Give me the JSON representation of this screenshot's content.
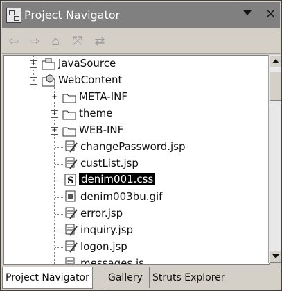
{
  "title": "Project Navigator",
  "titlebar": {
    "menu_icon": "view-menu-icon",
    "close_label": "×"
  },
  "toolbar": {
    "buttons": [
      {
        "name": "back",
        "glyph": "⇦"
      },
      {
        "name": "forward",
        "glyph": "⇨"
      },
      {
        "name": "up",
        "glyph": "⌂"
      },
      {
        "name": "collapse-all",
        "glyph": "⤧"
      },
      {
        "name": "link-with-editor",
        "glyph": "⇄"
      }
    ]
  },
  "tree": [
    {
      "label": "JavaSource",
      "icon": "java-source-folder-icon",
      "expander": "+",
      "depth": 1
    },
    {
      "label": "WebContent",
      "icon": "web-content-folder-icon",
      "expander": "-",
      "depth": 1
    },
    {
      "label": "META-INF",
      "icon": "folder-icon",
      "expander": "+",
      "depth": 2
    },
    {
      "label": "theme",
      "icon": "folder-icon",
      "expander": "+",
      "depth": 2
    },
    {
      "label": "WEB-INF",
      "icon": "folder-icon",
      "expander": "+",
      "depth": 2
    },
    {
      "label": "changePassword.jsp",
      "icon": "jsp-file-icon",
      "expander": "",
      "depth": 2
    },
    {
      "label": "custList.jsp",
      "icon": "jsp-file-icon",
      "expander": "",
      "depth": 2
    },
    {
      "label": "denim001.css",
      "icon": "css-file-icon",
      "expander": "",
      "depth": 2,
      "selected": true
    },
    {
      "label": "denim003bu.gif",
      "icon": "gif-file-icon",
      "expander": "",
      "depth": 2
    },
    {
      "label": "error.jsp",
      "icon": "jsp-file-icon",
      "expander": "",
      "depth": 2
    },
    {
      "label": "inquiry.jsp",
      "icon": "jsp-file-icon",
      "expander": "",
      "depth": 2
    },
    {
      "label": "logon.jsp",
      "icon": "jsp-file-icon",
      "expander": "",
      "depth": 2
    },
    {
      "label": "messages.js",
      "icon": "js-file-icon",
      "expander": "",
      "depth": 2
    }
  ],
  "tabs": [
    {
      "label": "Project Navigator",
      "active": true
    },
    {
      "label": "Gallery",
      "active": false
    },
    {
      "label": "Struts Explorer",
      "active": false
    }
  ]
}
